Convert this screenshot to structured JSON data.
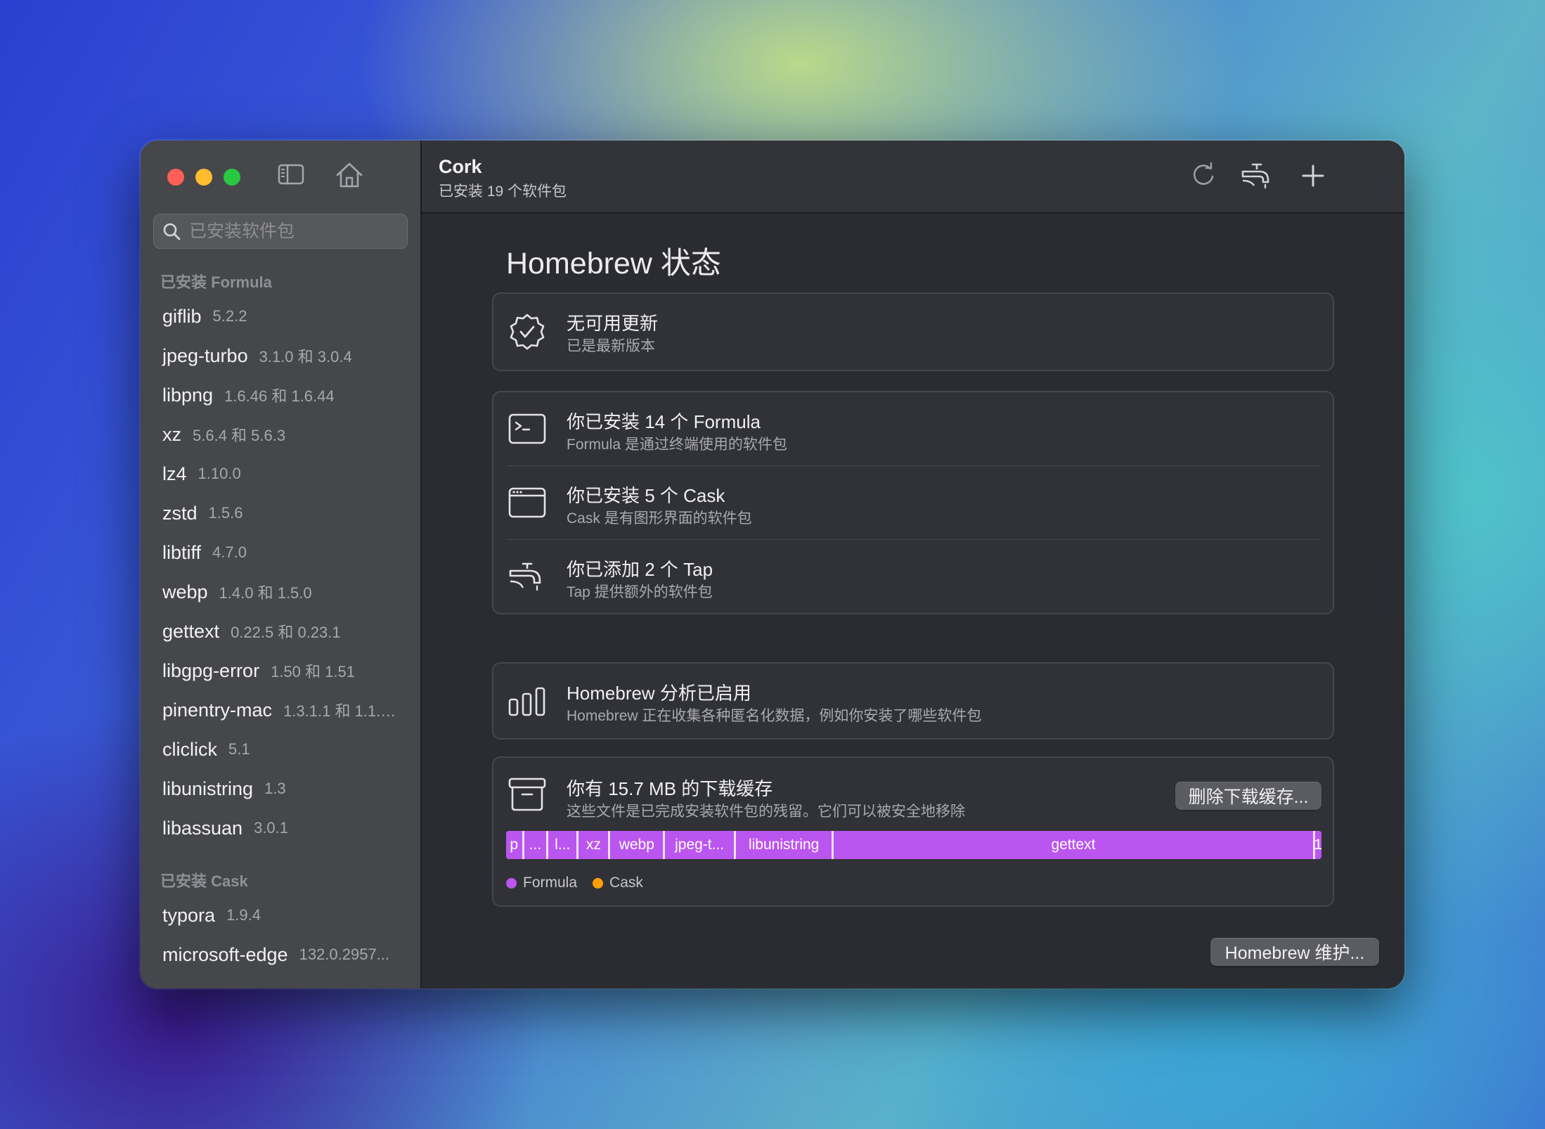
{
  "window": {
    "title": "Cork",
    "subtitle": "已安装 19 个软件包"
  },
  "sidebar": {
    "search_placeholder": "已安装软件包",
    "formula_section_title": "已安装 Formula",
    "formulae": [
      {
        "name": "giflib",
        "version": "5.2.2"
      },
      {
        "name": "jpeg-turbo",
        "version": "3.1.0 和 3.0.4"
      },
      {
        "name": "libpng",
        "version": "1.6.46 和 1.6.44"
      },
      {
        "name": "xz",
        "version": "5.6.4 和 5.6.3"
      },
      {
        "name": "lz4",
        "version": "1.10.0"
      },
      {
        "name": "zstd",
        "version": "1.5.6"
      },
      {
        "name": "libtiff",
        "version": "4.7.0"
      },
      {
        "name": "webp",
        "version": "1.4.0 和 1.5.0"
      },
      {
        "name": "gettext",
        "version": "0.22.5 和 0.23.1"
      },
      {
        "name": "libgpg-error",
        "version": "1.50 和 1.51"
      },
      {
        "name": "pinentry-mac",
        "version": "1.3.1.1 和 1.1.1...."
      },
      {
        "name": "cliclick",
        "version": "5.1"
      },
      {
        "name": "libunistring",
        "version": "1.3"
      },
      {
        "name": "libassuan",
        "version": "3.0.1"
      }
    ],
    "cask_section_title": "已安装 Cask",
    "casks": [
      {
        "name": "typora",
        "version": "1.9.4"
      },
      {
        "name": "microsoft-edge",
        "version": "132.0.2957..."
      }
    ]
  },
  "status": {
    "heading": "Homebrew 状态",
    "updates": {
      "title": "无可用更新",
      "subtitle": "已是最新版本"
    },
    "formula": {
      "title": "你已安装 14 个 Formula",
      "subtitle": "Formula 是通过终端使用的软件包"
    },
    "cask": {
      "title": "你已安装 5 个 Cask",
      "subtitle": "Cask 是有图形界面的软件包"
    },
    "tap": {
      "title": "你已添加 2 个 Tap",
      "subtitle": "Tap 提供额外的软件包"
    },
    "analytics": {
      "title": "Homebrew 分析已启用",
      "subtitle": "Homebrew 正在收集各种匿名化数据，例如你安装了哪些软件包"
    },
    "cache": {
      "title": "你有 15.7 MB 的下载缓存",
      "subtitle": "这些文件是已完成安装软件包的残留。它们可以被安全地移除",
      "delete_button": "删除下载缓存...",
      "segments": [
        {
          "label": "p",
          "share": 0.022
        },
        {
          "label": "...",
          "share": 0.03
        },
        {
          "label": "l...",
          "share": 0.037
        },
        {
          "label": "xz",
          "share": 0.039
        },
        {
          "label": "webp",
          "share": 0.067
        },
        {
          "label": "jpeg-t...",
          "share": 0.087
        },
        {
          "label": "libunistring",
          "share": 0.12
        },
        {
          "label": "gettext",
          "share": 0.59
        },
        {
          "label": "1",
          "share": 0.008
        }
      ],
      "legend": {
        "formula": "Formula",
        "cask": "Cask"
      },
      "colors": {
        "formula": "#bb55ef",
        "cask": "#ff9f0a"
      }
    },
    "maintenance_button": "Homebrew 维护..."
  }
}
